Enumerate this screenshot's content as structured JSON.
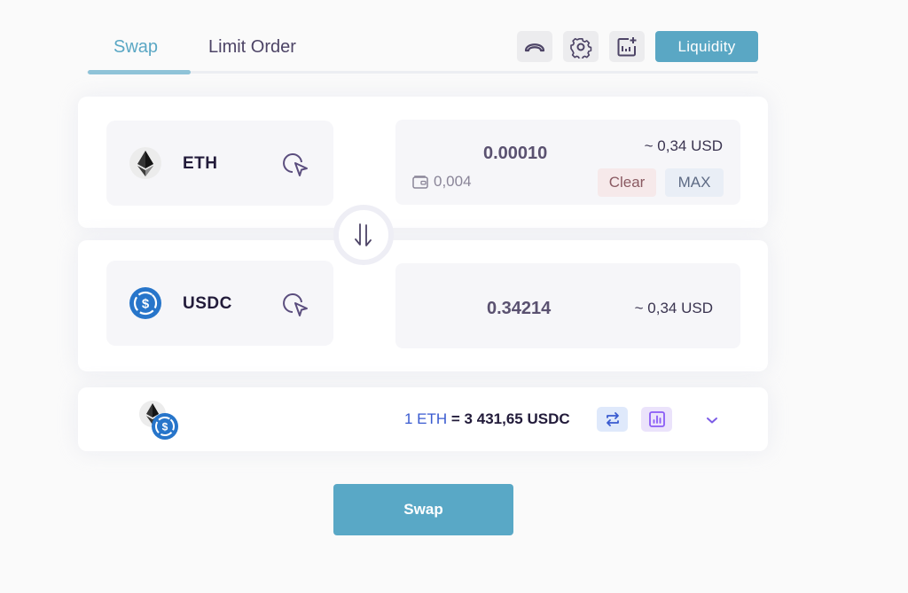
{
  "tabs": [
    {
      "label": "Swap",
      "active": true
    },
    {
      "label": "Limit Order",
      "active": false
    }
  ],
  "toolbar": {
    "icons": [
      "rainbow-icon",
      "gear-icon",
      "chart-add-icon"
    ],
    "liquidity_label": "Liquidity"
  },
  "from": {
    "token": "ETH",
    "token_icon": "eth-icon",
    "amount": "0.00010",
    "usd_value": "~ 0,34 USD",
    "balance": "0,004",
    "clear_label": "Clear",
    "max_label": "MAX"
  },
  "to": {
    "token": "USDC",
    "token_icon": "usdc-icon",
    "amount": "0.34214",
    "usd_value": "~ 0,34 USD"
  },
  "rate": {
    "lhs": "1 ETH",
    "rhs": " = 3 431,65 USDC"
  },
  "swap_button_label": "Swap",
  "colors": {
    "accent": "#5aa7c4",
    "clear_bg": "#f6e9ea",
    "max_bg": "#e9eef6",
    "rate_link": "#3a5bd0",
    "chart_purple": "#8b5cf6"
  }
}
